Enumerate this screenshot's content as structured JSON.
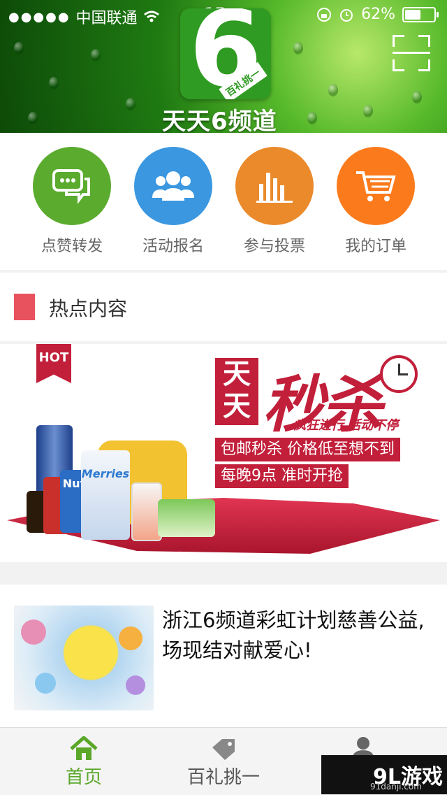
{
  "status_bar": {
    "carrier": "中国联通",
    "time": "15",
    "battery": "62%",
    "battery_level": 0.62
  },
  "header": {
    "logo_tag": "百礼挑一",
    "channel_name": "天天6频道",
    "scan_icon": "scan-icon"
  },
  "menu": [
    {
      "label": "点赞转发",
      "icon": "chat-bubbles-icon",
      "color": "#5aab2e"
    },
    {
      "label": "活动报名",
      "icon": "people-icon",
      "color": "#3a97e0"
    },
    {
      "label": "参与投票",
      "icon": "bar-chart-icon",
      "color": "#ea8a2b"
    },
    {
      "label": "我的订单",
      "icon": "shopping-cart-icon",
      "color": "#fb7a1b"
    }
  ],
  "section": {
    "title": "热点内容"
  },
  "banner": {
    "hot": "HOT",
    "big1": "天天",
    "big2": "秒杀",
    "sub": "疯狂进行  活动不停",
    "line1": "包邮秒杀  价格低至想不到",
    "line2": "每晚9点  准时开抢",
    "product_merries": "Merries",
    "product_nut": "Nut"
  },
  "article": {
    "title": "浙江6频道彩虹计划慈善公益,场现结对献爱心!"
  },
  "tabbar": {
    "tabs": [
      {
        "label": "首页",
        "icon": "home-icon",
        "color": "#5aa72a"
      },
      {
        "label": "百礼挑一",
        "icon": "tag-icon",
        "color": "#666666"
      },
      {
        "label": "",
        "icon": "user-icon",
        "color": "#666666"
      }
    ]
  },
  "watermark": {
    "brand": "9L游戏",
    "site": "91danji.com"
  }
}
